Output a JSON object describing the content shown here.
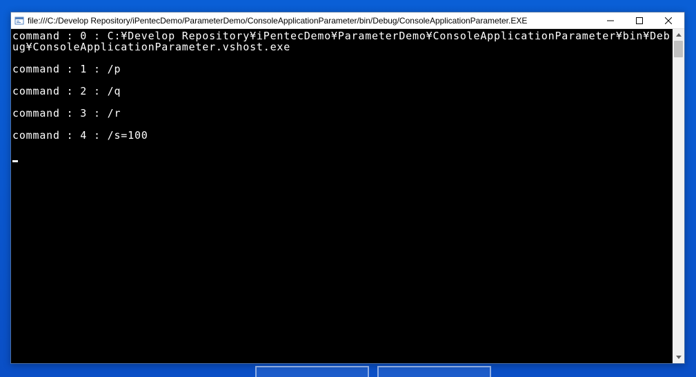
{
  "window": {
    "title": "file:///C:/Develop Repository/iPentecDemo/ParameterDemo/ConsoleApplicationParameter/bin/Debug/ConsoleApplicationParameter.EXE"
  },
  "console": {
    "lines": [
      "command : 0 : C:¥Develop Repository¥iPentecDemo¥ParameterDemo¥ConsoleApplicationParameter¥bin¥Debug¥ConsoleApplicationParameter.vshost.exe",
      "",
      "command : 1 : /p",
      "",
      "command : 2 : /q",
      "",
      "command : 3 : /r",
      "",
      "command : 4 : /s=100",
      ""
    ]
  }
}
